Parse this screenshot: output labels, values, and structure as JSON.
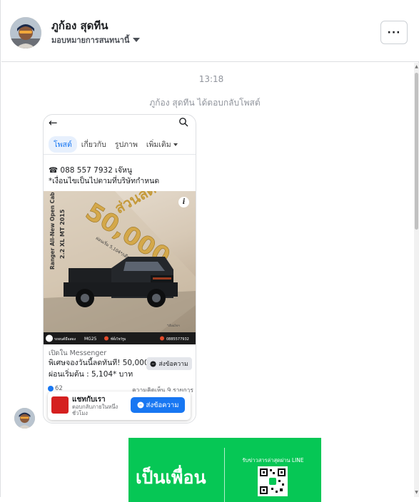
{
  "header": {
    "contact_name": "ภูก้อง สุดทีน",
    "assign_label": "มอบหมายการสนทนานี้",
    "more_label": "···"
  },
  "thread": {
    "timestamp": "13:18",
    "reply_note": "ภูก้อง สุดทีน ได้ตอบกลับโพสต์"
  },
  "post_card": {
    "tabs": [
      {
        "label": "โพสต์",
        "active": true
      },
      {
        "label": "เกี่ยวกับ",
        "active": false
      },
      {
        "label": "รูปภาพ",
        "active": false
      },
      {
        "label": "เพิ่มเติม",
        "active": false
      }
    ],
    "phone_line": "☎ 088 557 7932 เจ๊หนู",
    "condition_line": "*เงื่อนไขเป็นไปตามที่บริษัทกำหนด",
    "image": {
      "promo_big": "50,000",
      "promo_top": "ส่วนลด",
      "promo_small": "ผ่อนเริ่ม 5,104*/เดือน",
      "vertical_text": "Ranger All-New Open Cab",
      "vertical_sub": "2.2 XL MT 2015",
      "plate": "MG25",
      "dealer": "รถยนต์มือสอง",
      "phone_small": "0885577932"
    },
    "opened_in": "เปิดใน Messenger",
    "offer_line1": "พิเศษจองวันนี้ลดทันที! 50,000",
    "offer_line2": "ผ่อนเริ่มต้น : 5,104* บาท",
    "send_label": "ส่งข้อความ",
    "reactions": "62",
    "comments": "ความคิดเห็น 9 รายการ",
    "popup": {
      "title": "แชทกับเรา",
      "subtitle": "ตอบกลับภายในหนึ่งชั่วโมง",
      "button": "ส่งข้อความ"
    }
  },
  "line_banner": {
    "big_text": "เป็นเพื่อน",
    "small_text": "รับข่าวสารล่าสุดผ่าน LINE"
  },
  "colors": {
    "messenger_blue": "#1877f2",
    "line_green": "#06c755",
    "muted_text": "#90949c"
  }
}
